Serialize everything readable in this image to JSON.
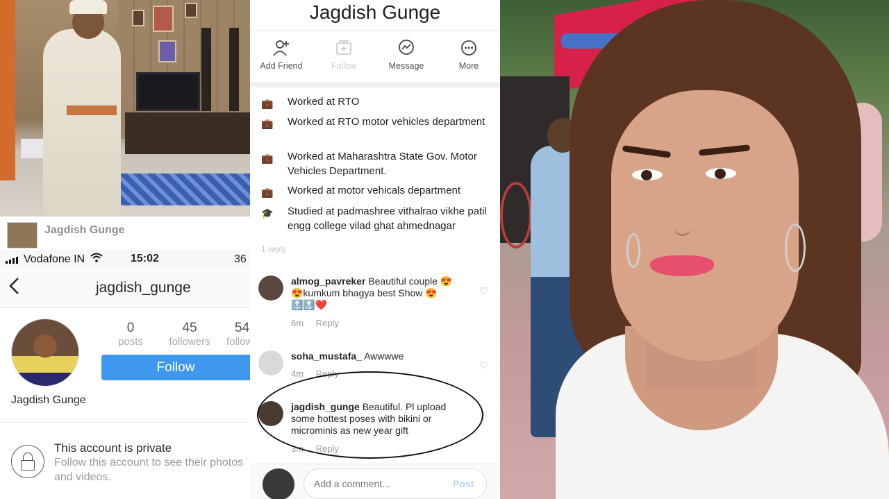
{
  "instagram": {
    "post_author": "Jagdish Gunge",
    "status_bar": {
      "carrier": "Vodafone IN",
      "time": "15:02",
      "battery": "36"
    },
    "nav": {
      "back_icon": "chevron-left-icon",
      "username": "jagdish_gunge"
    },
    "stats": [
      {
        "value": "0",
        "label": "posts"
      },
      {
        "value": "45",
        "label": "followers"
      },
      {
        "value": "54",
        "label": "following"
      }
    ],
    "follow_label": "Follow",
    "full_name": "Jagdish Gunge",
    "private_title": "This account is private",
    "private_subtitle": "Follow this account to see their photos and videos."
  },
  "facebook": {
    "profile_name": "Jagdish Gunge",
    "actions": [
      {
        "label": "Add Friend",
        "icon": "add-friend-icon",
        "enabled": true
      },
      {
        "label": "Follow",
        "icon": "follow-icon",
        "enabled": false
      },
      {
        "label": "Message",
        "icon": "messenger-icon",
        "enabled": true
      },
      {
        "label": "More",
        "icon": "more-icon",
        "enabled": true
      }
    ],
    "about": [
      {
        "icon": "briefcase-icon",
        "text": "Worked at RTO"
      },
      {
        "icon": "briefcase-icon",
        "text": "Worked at RTO motor vehicles department"
      },
      {
        "icon": "briefcase-icon",
        "text": "Worked at Maharashtra State Gov. Motor Vehicles Department."
      },
      {
        "icon": "briefcase-icon",
        "text": "Worked at motor vehicals department"
      },
      {
        "icon": "graduation-cap-icon",
        "text": "Studied at padmashree vithalrao vikhe patil engg college vilad ghat ahmednagar"
      }
    ]
  },
  "comments": [
    {
      "username": "almog_pavreker",
      "text": "Beautiful couple 😍😍kumkum bhagya best Show 😍🔝🔝❤️",
      "time": "6m",
      "reply": "Reply"
    },
    {
      "username": "soha_mustafa_",
      "text": "Awwwwe",
      "time": "4m",
      "reply": "Reply"
    },
    {
      "username": "jagdish_gunge",
      "text": "Beautiful. Pl upload some hottest poses with bikini or microminis as new year gift",
      "time": "3m",
      "reply": "Reply"
    }
  ],
  "comment_ghost": "1 reply",
  "comment_box": {
    "placeholder": "Add a comment...",
    "post_label": "Post"
  },
  "colors": {
    "follow_blue": "#3f97ee",
    "highlight_ellipse": "#111111",
    "lipstick": "#e5506f"
  }
}
